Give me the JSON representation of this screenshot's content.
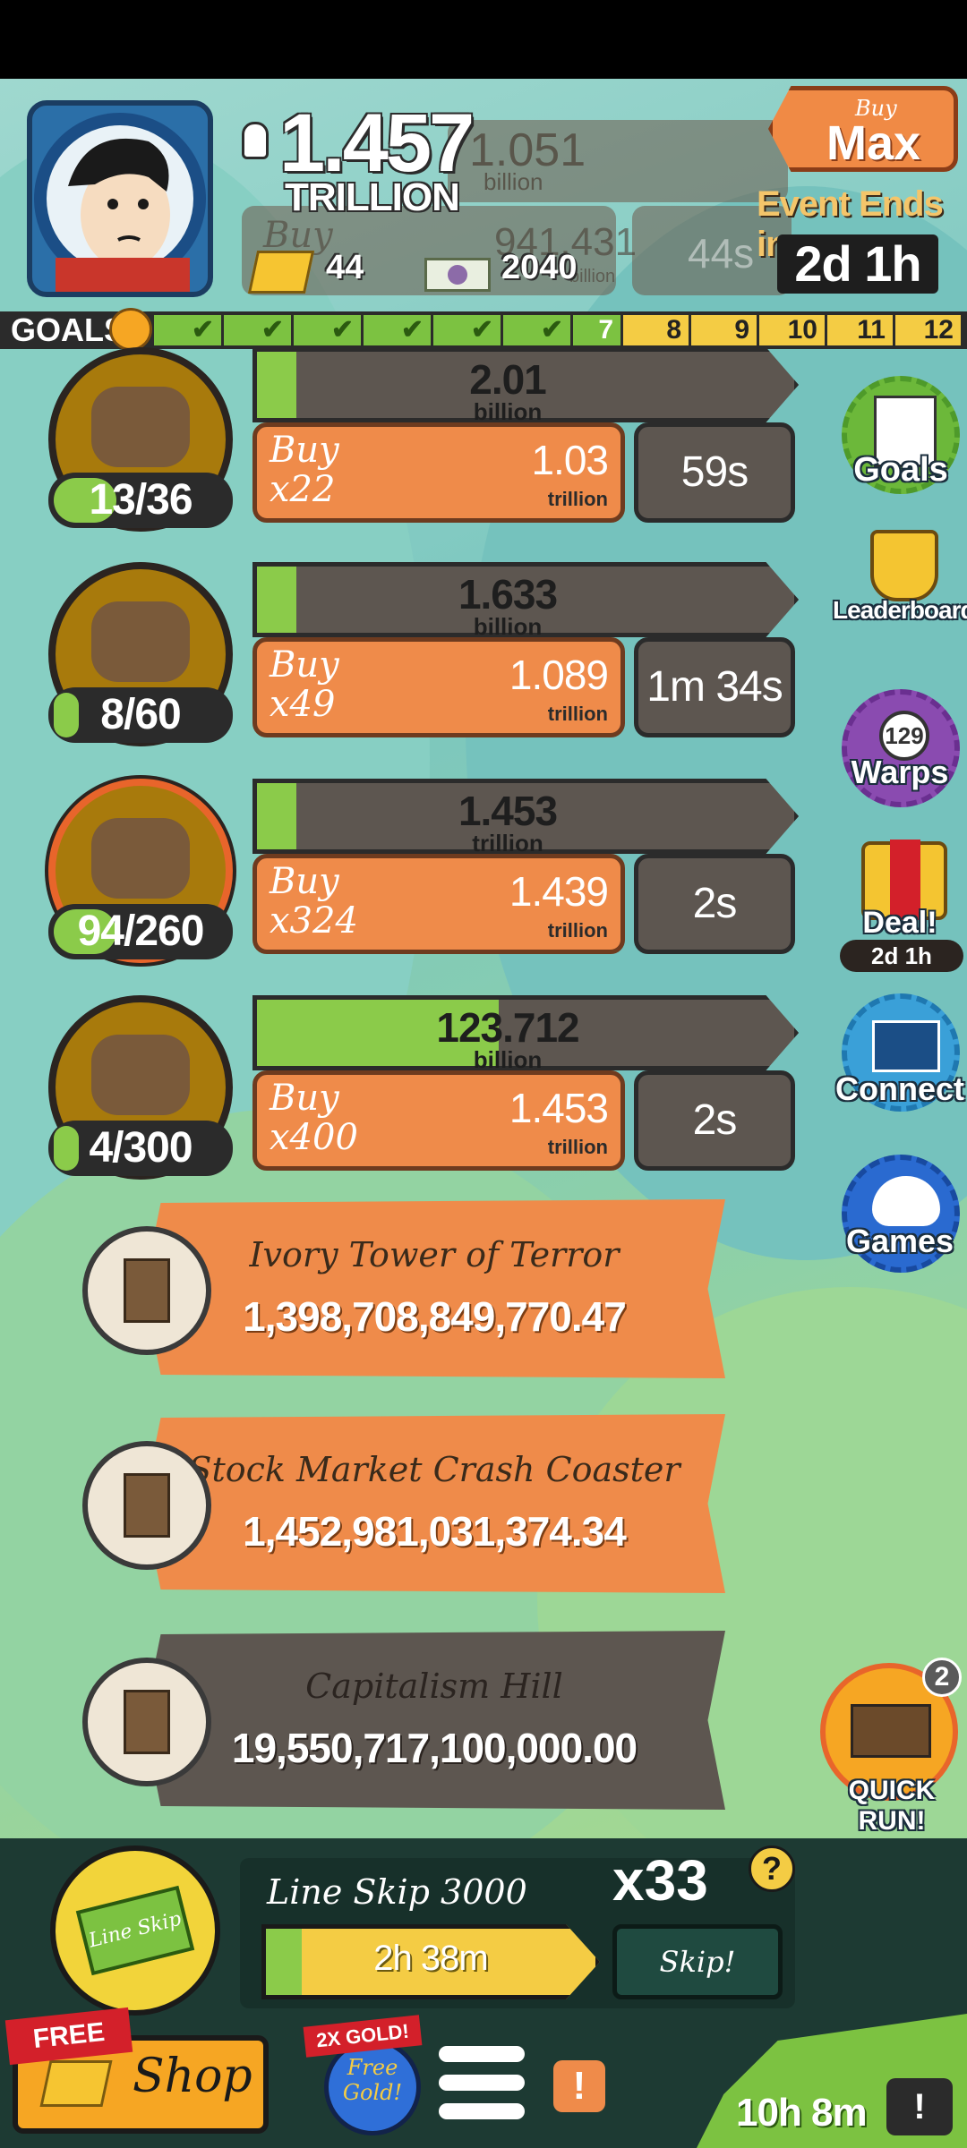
{
  "header": {
    "money_value": "1.457",
    "money_unit": "TRILLION",
    "gold": "44",
    "megabucks": "2040",
    "buy_max_small": "Buy",
    "buy_max_big": "Max",
    "event_label": "Event Ends in:",
    "event_timer": "2d 1h",
    "ghost_values": [
      "1.051",
      "billion",
      "941.431",
      "billion",
      "Buy",
      "44s"
    ]
  },
  "goals": {
    "label": "GOALS",
    "cells": [
      {
        "label": "",
        "done": true
      },
      {
        "label": "",
        "done": true
      },
      {
        "label": "",
        "done": true
      },
      {
        "label": "",
        "done": true
      },
      {
        "label": "",
        "done": true
      },
      {
        "label": "",
        "done": true
      },
      {
        "label": "7",
        "done": true
      },
      {
        "label": "8",
        "done": false
      },
      {
        "label": "9",
        "done": false
      },
      {
        "label": "10",
        "done": false
      },
      {
        "label": "11",
        "done": false
      },
      {
        "label": "12",
        "done": false
      }
    ]
  },
  "businesses": [
    {
      "count": "13/36",
      "count_fraction": 0.36,
      "progress_value": "2.01",
      "progress_unit": "billion",
      "progress_fraction": 0.05,
      "buy_label": "Buy",
      "buy_qty": "x22",
      "cost": "1.03",
      "cost_unit": "trillion",
      "timer": "59s",
      "icon": "message-bottle-icon"
    },
    {
      "count": "8/60",
      "count_fraction": 0.13,
      "progress_value": "1.633",
      "progress_unit": "billion",
      "progress_fraction": 0.03,
      "buy_label": "Buy",
      "buy_qty": "x49",
      "cost": "1.089",
      "cost_unit": "trillion",
      "timer": "1m 34s",
      "icon": "drumstick-icon"
    },
    {
      "count": "94/260",
      "count_fraction": 0.36,
      "progress_value": "1.453",
      "progress_unit": "trillion",
      "progress_fraction": 0.0,
      "buy_label": "Buy",
      "buy_qty": "x324",
      "cost": "1.439",
      "cost_unit": "trillion",
      "timer": "2s",
      "icon": "zoo-cage-icon"
    },
    {
      "count": "4/300",
      "count_fraction": 0.01,
      "progress_value": "123.712",
      "progress_unit": "billion",
      "progress_fraction": 0.45,
      "buy_label": "Buy",
      "buy_qty": "x400",
      "cost": "1.453",
      "cost_unit": "trillion",
      "timer": "2s",
      "icon": "butterfly-net-icon"
    }
  ],
  "side_menu": {
    "goals": "Goals",
    "leaderboard": "Leaderboard",
    "warps": "Warps",
    "warps_count": "129",
    "deal": "Deal!",
    "deal_timer": "2d 1h",
    "connect": "Connect",
    "games": "Games"
  },
  "ribbons": [
    {
      "name": "Ivory Tower of Terror",
      "amount": "1,398,708,849,770.47",
      "color": "#ef8b4a",
      "icon": "ivory-tower-icon"
    },
    {
      "name": "Stock Market Crash Coaster",
      "amount": "1,452,981,031,374.34",
      "color": "#ef8b4a",
      "icon": "coaster-icon"
    },
    {
      "name": "Capitalism Hill",
      "amount": "19,550,717,100,000.00",
      "color": "#5d5650",
      "icon": "capitalism-hill-icon"
    }
  ],
  "quick_run": {
    "label": "QUICK RUN!",
    "badge": "2"
  },
  "line_skip": {
    "icon_text": "Line Skip",
    "title": "Line Skip 3000",
    "multiplier": "x33",
    "help": "?",
    "time": "2h 38m",
    "progress_fraction": 0.08,
    "skip_label": "Skip!"
  },
  "bottom_bar": {
    "free_tag": "FREE",
    "shop_label": "Shop",
    "x2gold_tag": "2X GOLD!",
    "free_gold_label": "Free Gold!",
    "alert": "!",
    "tv_timer": "10h 8m",
    "tv_icon": "!"
  }
}
